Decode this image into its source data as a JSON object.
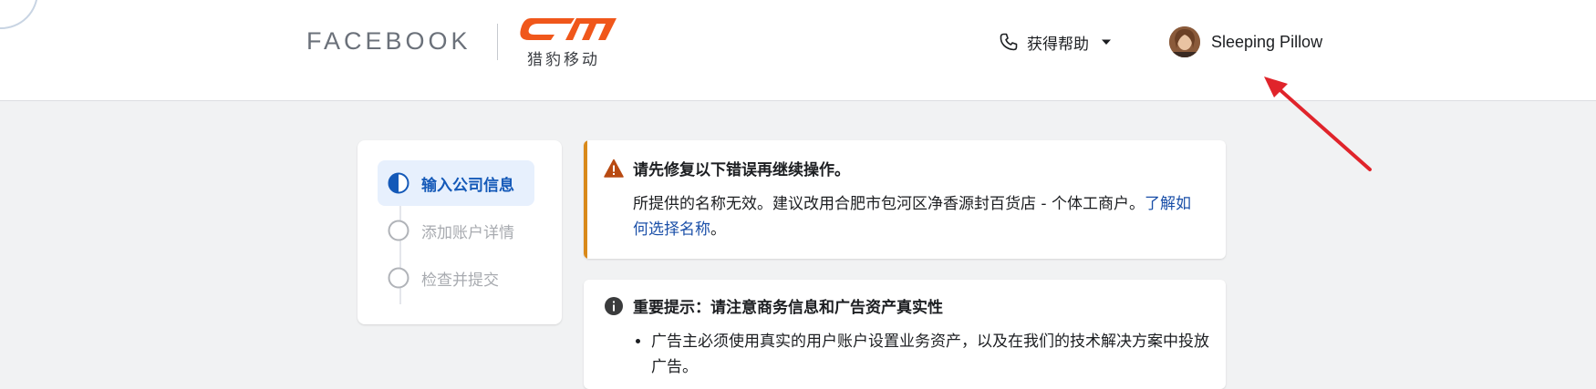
{
  "header": {
    "facebook_wordmark": "FACEBOOK",
    "partner_logo_mark": "cm",
    "partner_name": "猎豹移动",
    "help_label": "获得帮助",
    "user_name": "Sleeping Pillow"
  },
  "icons": {
    "help": "phone-icon",
    "help_dropdown": "caret-down-icon",
    "avatar": "user-avatar-photo",
    "error": "warning-triangle-icon",
    "notice": "info-circle-icon",
    "step_active": "half-filled-circle-icon",
    "step_inactive": "empty-circle-icon"
  },
  "colors": {
    "accent_blue": "#1459b8",
    "active_step_bg": "#e7f0fd",
    "warning_accent": "#d9891a",
    "warning_icon": "#b84a12",
    "link": "#1a4fa8",
    "partner_orange": "#f0571b",
    "annotation_red": "#e0242b",
    "page_bg": "#f1f2f3"
  },
  "steps": [
    {
      "label": "输入公司信息",
      "state": "active"
    },
    {
      "label": "添加账户详情",
      "state": "inactive"
    },
    {
      "label": "检查并提交",
      "state": "inactive"
    }
  ],
  "error_card": {
    "title": "请先修复以下错误再继续操作。",
    "message": "所提供的名称无效。建议改用合肥市包河区净香源封百货店 - 个体工商户。",
    "link_text": "了解如何选择名称",
    "message_end": "。"
  },
  "notice_card": {
    "title": "重要提示：请注意商务信息和广告资产真实性",
    "bullets": [
      "广告主必须使用真实的用户账户设置业务资产，以及在我们的技术解决方案中投放广告。"
    ]
  }
}
